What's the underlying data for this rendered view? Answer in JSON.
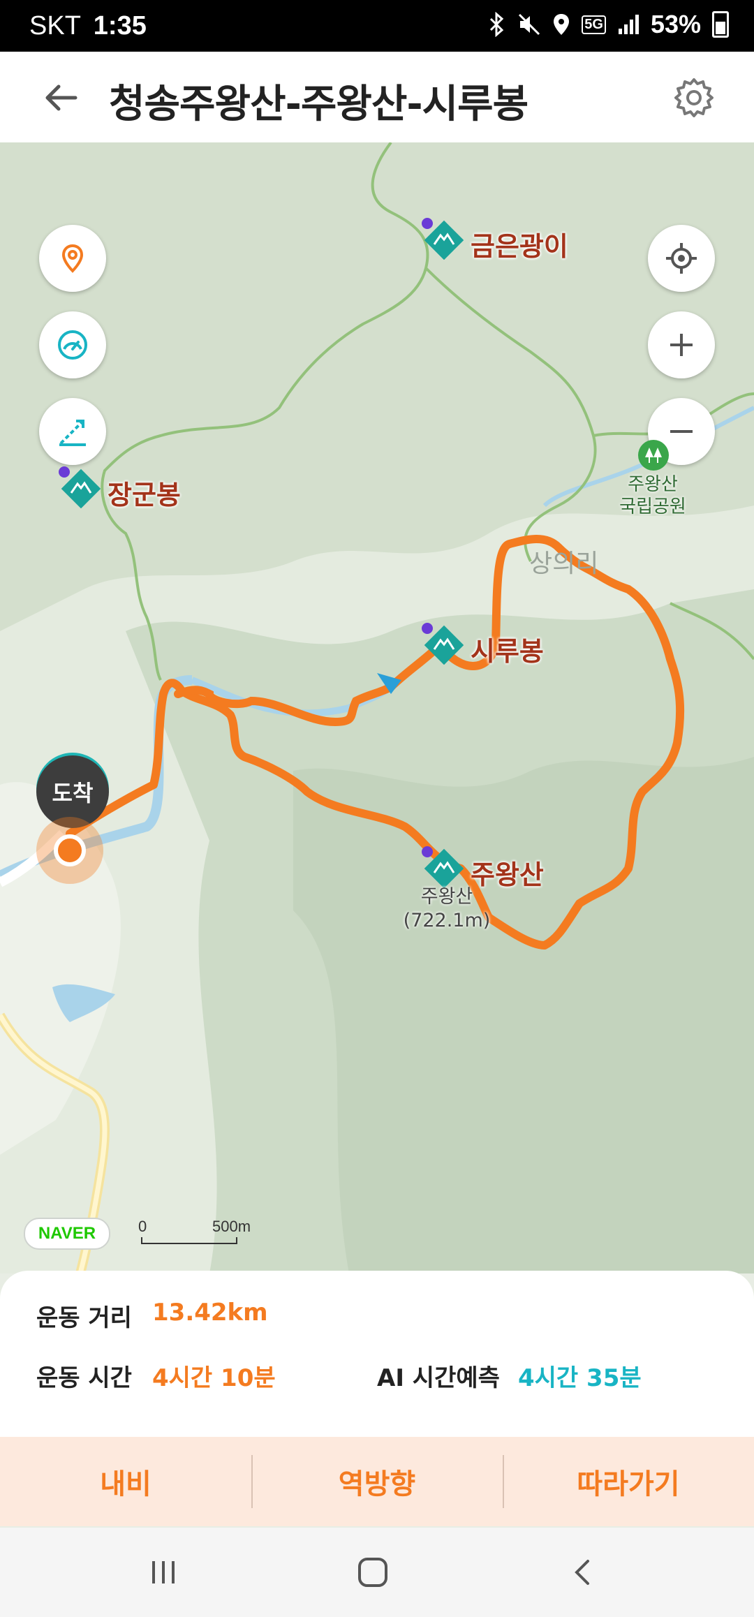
{
  "status_bar": {
    "carrier": "SKT",
    "time": "1:35",
    "battery": "53%",
    "network": "5G",
    "icons": [
      "bluetooth-icon",
      "mute-icon",
      "location-icon",
      "5g-icon",
      "signal-icon",
      "battery-icon"
    ]
  },
  "header": {
    "title": "청송주왕산-주왕산-시루봉",
    "back_icon": "back-arrow-icon",
    "settings_icon": "gear-icon"
  },
  "map": {
    "peaks": [
      {
        "name": "금은광이"
      },
      {
        "name": "장군봉"
      },
      {
        "name": "시루봉"
      },
      {
        "name": "주왕산",
        "detail_name": "주왕산",
        "elevation": "(722.1m)"
      }
    ],
    "park": {
      "line1": "주왕산",
      "line2": "국립공원"
    },
    "village": "상의리",
    "arrival_badge": "도착",
    "provider": "NAVER",
    "scale": {
      "zero": "0",
      "distance": "500m"
    },
    "left_controls": [
      "pin-icon",
      "speedometer-icon",
      "elevation-icon"
    ],
    "right_controls": [
      "locate-icon",
      "zoom-in-icon",
      "zoom-out-icon"
    ],
    "route_color": "#f47b20"
  },
  "stats": {
    "distance_label": "운동 거리",
    "distance_value": "13.42km",
    "time_label": "운동 시간",
    "time_value": "4시간 10분",
    "ai_label": "AI 시간예측",
    "ai_value": "4시간 35분"
  },
  "actions": {
    "navi": "내비",
    "reverse": "역방향",
    "follow": "따라가기"
  },
  "nav_bar": [
    "recent-apps-icon",
    "home-icon",
    "back-icon"
  ]
}
